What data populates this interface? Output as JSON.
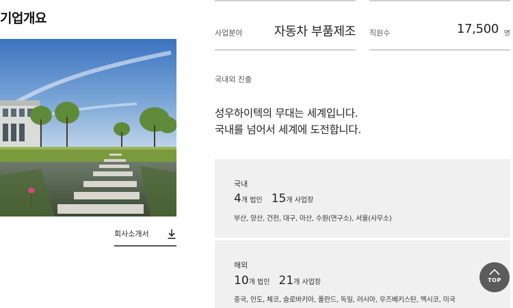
{
  "overview": {
    "title": "기업개요",
    "brochure_label": "회사소개서",
    "brochure_icon": "download-icon"
  },
  "business_field": {
    "label": "사업분야",
    "value": "자동차 부품제조"
  },
  "employees": {
    "label": "직원수",
    "value": "17,500",
    "unit": "명"
  },
  "global": {
    "label": "국내외 진출",
    "headline_lines": [
      "성우하이텍의 무대는 세계입니다.",
      "국내를 넘어서 세계에 도전합니다."
    ]
  },
  "domestic": {
    "name": "국내",
    "corp_count": "4",
    "corp_unit": "개 법인",
    "site_count": "15",
    "site_unit": "개 사업장",
    "locations": "부산, 양산, 건천, 대구, 아산, 수원(연구소), 서울(사무소)"
  },
  "overseas": {
    "name": "해외",
    "corp_count": "10",
    "corp_unit": "개 법인",
    "site_count": "21",
    "site_unit": "개 사업장",
    "locations": "중국, 인도, 체코, 슬로바키아, 폴란드, 독일, 러시아, 우즈베키스탄, 멕시코, 미국"
  },
  "top_button": {
    "label": "TOP",
    "icon": "chevron-up-icon"
  },
  "colors": {
    "panel_bg": "#f0f0f0",
    "top_button_bg": "#5b5b5b",
    "divider": "#cfcfcf"
  }
}
